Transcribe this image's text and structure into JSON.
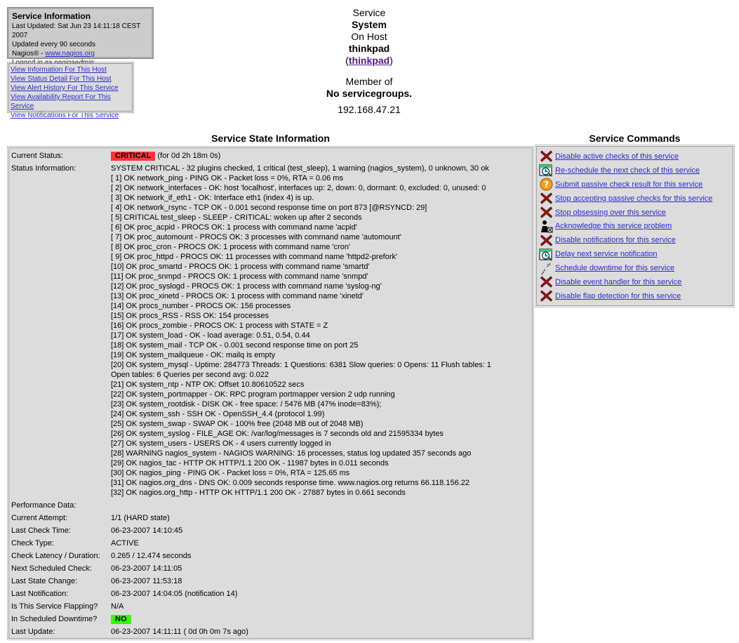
{
  "info": {
    "title": "Service Information",
    "last_updated": "Last Updated: Sat Jun 23 14:11:18 CEST 2007",
    "update_interval": "Updated every 90 seconds",
    "nagios_prefix": "Nagios® - ",
    "nagios_link": "www.nagios.org",
    "logged_in_prefix": "Logged in as ",
    "logged_in_user": "nagiosadmin"
  },
  "links": [
    "View Information For This Host",
    "View Status Detail For This Host",
    "View Alert History For This Service",
    "View Availability Report For This Service",
    "View Notifications For This Service"
  ],
  "host_header": {
    "service_label": "Service",
    "service_name": "System",
    "on_host_label": "On Host",
    "host_name": "thinkpad",
    "host_link": "thinkpad",
    "member_of_label": "Member of",
    "groups": "No servicegroups.",
    "ip": "192.168.47.21"
  },
  "state_title": "Service State Information",
  "commands_title": "Service Commands",
  "state": {
    "current_status_label": "Current Status:",
    "current_status": "CRITICAL",
    "current_status_duration": "(for 0d 2h 18m 0s)",
    "status_info_label": "Status Information:",
    "status_info": [
      "SYSTEM CRITICAL - 32 plugins checked, 1 critical (test_sleep), 1 warning (nagios_system), 0 unknown, 30 ok",
      "[ 1] OK network_ping - PING OK - Packet loss = 0%, RTA = 0.06 ms",
      "[ 2] OK network_interfaces - OK: host 'localhost', interfaces up: 2, down: 0, dormant: 0, excluded: 0, unused: 0",
      "[ 3] OK network_if_eth1 - OK: Interface eth1 (index 4) is up.",
      "[ 4] OK network_rsync - TCP OK - 0.001 second response time on port 873 [@RSYNCD: 29]",
      "[ 5] CRITICAL test_sleep - SLEEP - CRITICAL: woken up after 2 seconds",
      "[ 6] OK proc_acpid - PROCS OK: 1 process with command name 'acpid'",
      "[ 7] OK proc_automount - PROCS OK: 3 processes with command name 'automount'",
      "[ 8] OK proc_cron - PROCS OK: 1 process with command name 'cron'",
      "[ 9] OK proc_httpd - PROCS OK: 11 processes with command name 'httpd2-prefork'",
      "[10] OK proc_smartd - PROCS OK: 1 process with command name 'smartd'",
      "[11] OK proc_snmpd - PROCS OK: 1 process with command name 'snmpd'",
      "[12] OK proc_syslogd - PROCS OK: 1 process with command name 'syslog-ng'",
      "[13] OK proc_xinetd - PROCS OK: 1 process with command name 'xinetd'",
      "[14] OK procs_number - PROCS OK: 156 processes",
      "[15] OK procs_RSS - RSS OK: 154 processes",
      "[16] OK procs_zombie - PROCS OK: 1 process with STATE = Z",
      "[17] OK system_load - OK - load average: 0.51, 0.54, 0.44",
      "[18] OK system_mail - TCP OK - 0.001 second response time on port 25",
      "[19] OK system_mailqueue - OK: mailq is empty",
      "[20] OK system_mysql - Uptime: 284773 Threads: 1 Questions: 6381 Slow queries: 0 Opens: 11 Flush tables: 1",
      "Open tables: 6 Queries per second avg: 0.022",
      "[21] OK system_ntp - NTP OK: Offset 10.80610522 secs",
      "[22] OK system_portmapper - OK: RPC program portmapper version 2 udp running",
      "[23] OK system_rootdisk - DISK OK - free space: / 5476 MB (47% inode=83%);",
      "[24] OK system_ssh - SSH OK - OpenSSH_4.4 (protocol 1.99)",
      "[25] OK system_swap - SWAP OK - 100% free (2048 MB out of 2048 MB)",
      "[26] OK system_syslog - FILE_AGE OK: /var/log/messages is 7 seconds old and 21595334 bytes",
      "[27] OK system_users - USERS OK - 4 users currently logged in",
      "[28] WARNING nagios_system - NAGIOS WARNING: 16 processes, status log updated 357 seconds ago",
      "[29] OK nagios_tac - HTTP OK HTTP/1.1 200 OK - 11987 bytes in 0.011 seconds",
      "[30] OK nagios_ping - PING OK - Packet loss = 0%, RTA = 125.65 ms",
      "[31] OK nagios.org_dns - DNS OK: 0.009 seconds response time. www.nagios.org returns 66.118.156.22",
      "[32] OK nagios.org_http - HTTP OK HTTP/1.1 200 OK - 27887 bytes in 0.661 seconds"
    ],
    "perf_label": "Performance Data:",
    "perf_value": "",
    "attempt_label": "Current Attempt:",
    "attempt_value": "1/1  (HARD state)",
    "last_check_label": "Last Check Time:",
    "last_check_value": "06-23-2007 14:10:45",
    "check_type_label": "Check Type:",
    "check_type_value": "ACTIVE",
    "latency_label": "Check Latency / Duration:",
    "latency_value": "0.265 / 12.474 seconds",
    "next_check_label": "Next Scheduled Check:",
    "next_check_value": "06-23-2007 14:11:05",
    "last_change_label": "Last State Change:",
    "last_change_value": "06-23-2007 11:53:18",
    "last_notif_label": "Last Notification:",
    "last_notif_value": "06-23-2007 14:04:05 (notification 14)",
    "flapping_label": "Is This Service Flapping?",
    "flapping_value": "N/A",
    "downtime_label": "In Scheduled Downtime?",
    "downtime_value": "NO",
    "last_update_label": "Last Update:",
    "last_update_value": "06-23-2007 14:11:11  ( 0d 0h 0m 7s ago)"
  },
  "colors": {
    "critical": "#f83838",
    "ok": "#33ff00",
    "panel": "#dcdcdc"
  },
  "commands": [
    {
      "icon": "disabled-x-icon",
      "label": "Disable active checks of this service"
    },
    {
      "icon": "reschedule-icon",
      "label": "Re-schedule the next check of this service"
    },
    {
      "icon": "passive-question-icon",
      "label": "Submit passive check result for this service"
    },
    {
      "icon": "disabled-x-icon",
      "label": "Stop accepting passive checks for this service"
    },
    {
      "icon": "disabled-x-icon",
      "label": "Stop obsessing over this service"
    },
    {
      "icon": "acknowledge-icon",
      "label": "Acknowledge this service problem"
    },
    {
      "icon": "disabled-x-icon",
      "label": "Disable notifications for this service"
    },
    {
      "icon": "delay-icon",
      "label": "Delay next service notification"
    },
    {
      "icon": "downtime-icon",
      "label": "Schedule downtime for this service"
    },
    {
      "icon": "disabled-x-icon",
      "label": "Disable event handler for this service"
    },
    {
      "icon": "disabled-x-icon",
      "label": "Disable flap detection for this service"
    }
  ]
}
